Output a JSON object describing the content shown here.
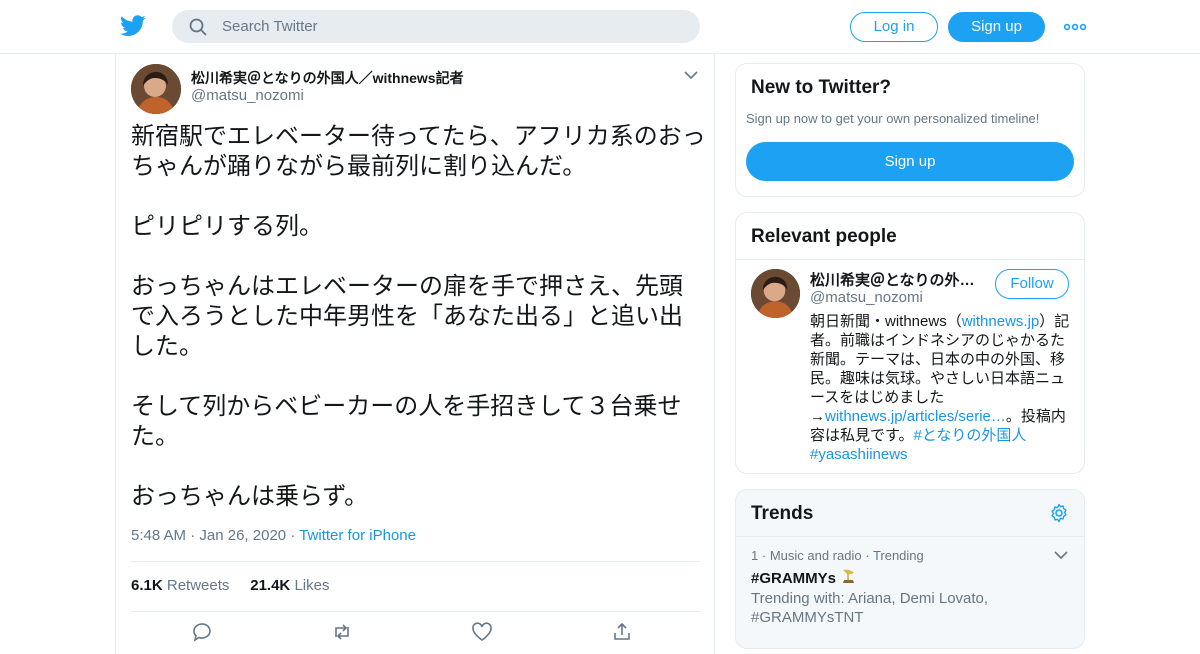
{
  "colors": {
    "accent": "#1da1f2",
    "link": "#1b95e0",
    "muted": "#657786",
    "border": "#e6ecf0",
    "trends_bg": "#f5f8fa"
  },
  "topbar": {
    "logo_icon": "twitter-bird-icon",
    "search_placeholder": "Search Twitter",
    "login_label": "Log in",
    "signup_label": "Sign up",
    "more_icon": "more-dots-icon"
  },
  "tweet": {
    "author_name": "松川希実＠となりの外国人／withnews記者",
    "author_handle": "@matsu_nozomi",
    "paragraphs": [
      "新宿駅でエレベーター待ってたら、アフリカ系のおっちゃんが踊りながら最前列に割り込んだ。",
      "ピリピリする列。",
      "おっちゃんはエレベーターの扉を手で押さえ、先頭で入ろうとした中年男性を「あなた出る」と追い出した。",
      "そして列からベビーカーの人を手招きして３台乗せた。",
      "おっちゃんは乗らず。"
    ],
    "time": "5:48 AM",
    "date": "Jan 26, 2020",
    "source": "Twitter for iPhone",
    "retweets_count": "6.1K",
    "retweets_label": "Retweets",
    "likes_count": "21.4K",
    "likes_label": "Likes"
  },
  "new_to_twitter": {
    "title": "New to Twitter?",
    "subtitle": "Sign up now to get your own personalized timeline!",
    "button_label": "Sign up"
  },
  "relevant_people": {
    "title": "Relevant people",
    "name": "松川希実＠となりの外国人／withnews記者",
    "handle": "@matsu_nozomi",
    "follow_label": "Follow",
    "bio_1": "朝日新聞・withnews（",
    "bio_link_1": "withnews.jp",
    "bio_2": "）記者。前職はインドネシアのじゃかるた新聞。テーマは、日本の中の外国、移民。趣味は気球。やさしい日本語ニュースをはじめました→",
    "bio_link_2": "withnews.jp/articles/serie…",
    "bio_3": "。投稿内容は私見です。",
    "bio_tag_1": "#となりの外国人",
    "bio_tag_2": "#yasashiinews"
  },
  "trends": {
    "title": "Trends",
    "items": [
      {
        "rank": "1",
        "category": "Music and radio",
        "status": "Trending",
        "tag": "#GRAMMYs",
        "trending_with": "Trending with: Ariana, Demi Lovato, #GRAMMYsTNT"
      }
    ]
  }
}
